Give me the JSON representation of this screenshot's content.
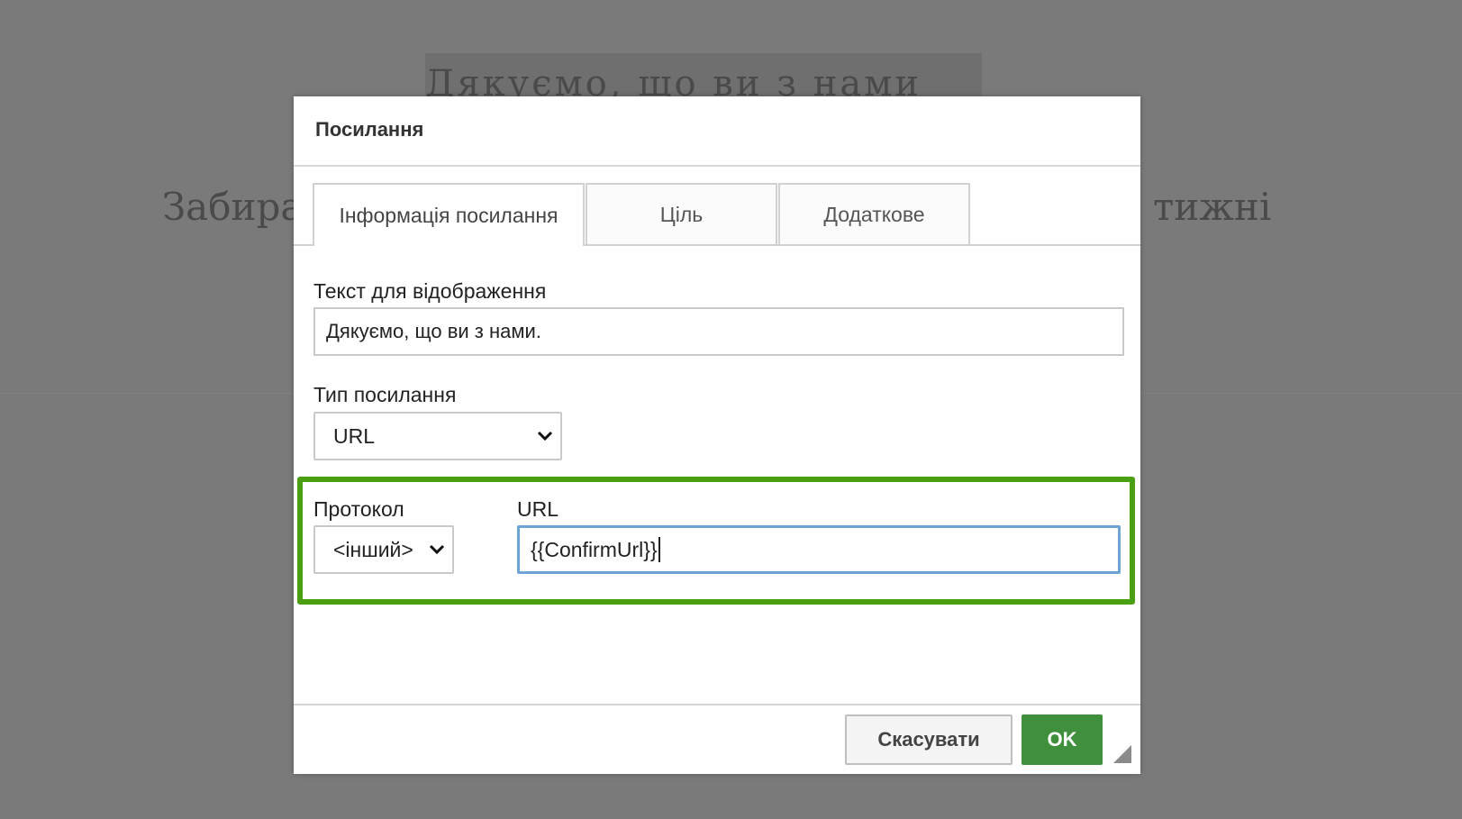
{
  "background": {
    "heading": "Дякуємо,  що  ви  з  нами",
    "text_left": "Забира",
    "text_right": "тижні"
  },
  "dialog": {
    "title": "Посилання",
    "tabs": [
      {
        "label": "Інформація посилання",
        "active": true
      },
      {
        "label": "Ціль",
        "active": false
      },
      {
        "label": "Додаткове",
        "active": false
      }
    ],
    "display_text": {
      "label": "Текст для відображення",
      "value": "Дякуємо, що ви з нами."
    },
    "link_type": {
      "label": "Тип посилання",
      "value": "URL"
    },
    "protocol": {
      "label": "Протокол",
      "value": "<інший>"
    },
    "url": {
      "label": "URL",
      "value": "{{ConfirmUrl}}"
    },
    "buttons": {
      "cancel": "Скасувати",
      "ok": "OK"
    }
  },
  "colors": {
    "overlay": "#7a7a7a",
    "highlight": "#4aa012",
    "ok_button": "#3f8f3c",
    "focus_border": "#6ea3d6"
  },
  "icons": {
    "select_arrow": "chevron-down-icon",
    "resize": "resize-handle-icon"
  }
}
